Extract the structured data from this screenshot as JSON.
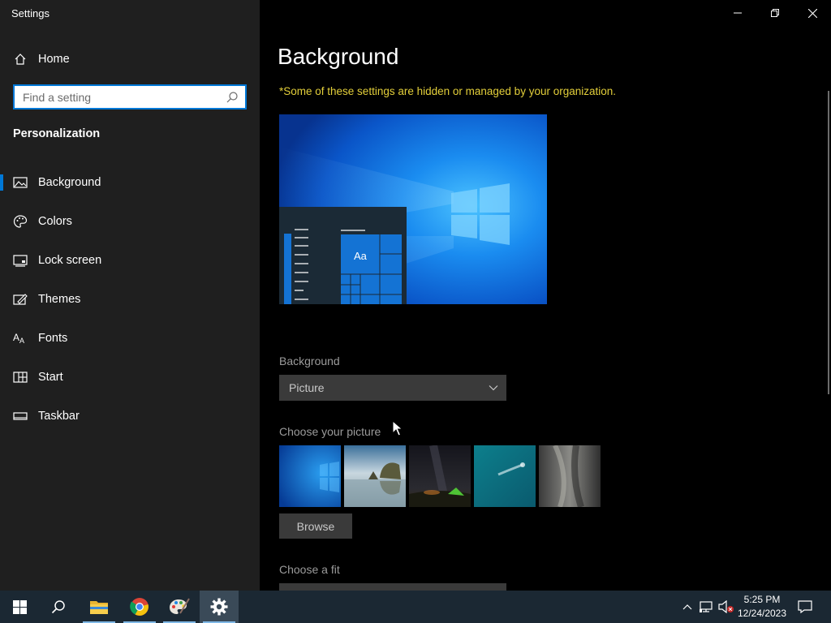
{
  "window": {
    "title": "Settings"
  },
  "nav": {
    "home_label": "Home",
    "search_placeholder": "Find a setting",
    "section_heading": "Personalization",
    "items": [
      {
        "label": "Background",
        "icon": "picture-icon",
        "active": true
      },
      {
        "label": "Colors",
        "icon": "palette-icon",
        "active": false
      },
      {
        "label": "Lock screen",
        "icon": "lock-screen-icon",
        "active": false
      },
      {
        "label": "Themes",
        "icon": "themes-icon",
        "active": false
      },
      {
        "label": "Fonts",
        "icon": "fonts-icon",
        "active": false
      },
      {
        "label": "Start",
        "icon": "start-icon",
        "active": false
      },
      {
        "label": "Taskbar",
        "icon": "taskbar-icon",
        "active": false
      }
    ]
  },
  "main": {
    "title": "Background",
    "notice": "*Some of these settings are hidden or managed by your organization.",
    "preview_tile_label": "Aa",
    "background_label": "Background",
    "background_value": "Picture",
    "choose_picture_label": "Choose your picture",
    "thumbnails": [
      "windows-blue-wallpaper",
      "coastal-rocks-wallpaper",
      "night-sky-tent-wallpaper",
      "underwater-swimmer-wallpaper",
      "rock-cliff-wallpaper"
    ],
    "browse_label": "Browse",
    "fit_label": "Choose a fit"
  },
  "taskbar": {
    "apps": [
      "start-icon",
      "search-icon",
      "file-explorer-icon",
      "chrome-icon",
      "paint-icon",
      "settings-icon"
    ],
    "time": "5:25 PM",
    "date": "12/24/2023"
  },
  "colors": {
    "accent": "#0078d7",
    "notice": "#e3cf3a",
    "nav_background": "#1f1f1f",
    "taskbar_background": "#1b2833"
  }
}
